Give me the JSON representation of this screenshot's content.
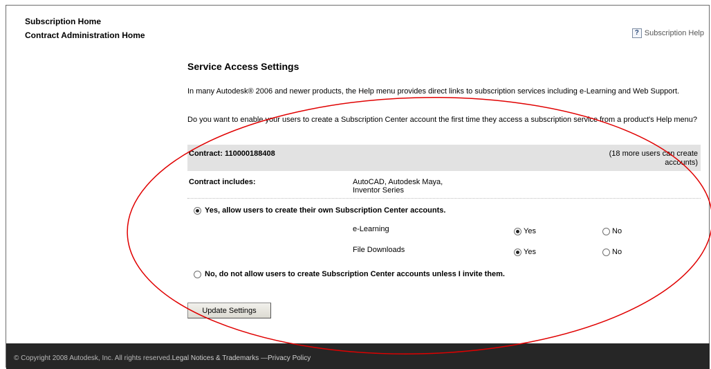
{
  "nav": {
    "subscription_home": "Subscription Home",
    "contract_admin_home": "Contract Administration Home"
  },
  "help": {
    "icon": "?",
    "label": "Subscription Help"
  },
  "main": {
    "title": "Service Access Settings",
    "para1": "In many Autodesk® 2006 and newer products, the Help menu provides direct links to subscription services including e-Learning and Web Support.",
    "para2": "Do you want to enable your users to create a Subscription Center account the first time they access a subscription service from a product's Help menu?",
    "contract": {
      "label": "Contract: 110000188408",
      "more_users": "(18 more users can create accounts)",
      "includes_label": "Contract includes:",
      "includes_line1": "AutoCAD, Autodesk Maya,",
      "includes_line2": "Inventor Series"
    },
    "option_yes": {
      "label": "Yes, allow users to create their own Subscription Center accounts.",
      "selected": true
    },
    "services": [
      {
        "name": "e-Learning",
        "yes": "Yes",
        "no": "No",
        "value": "Yes"
      },
      {
        "name": "File Downloads",
        "yes": "Yes",
        "no": "No",
        "value": "Yes"
      }
    ],
    "option_no": {
      "label": "No, do not allow users to create Subscription Center accounts unless I invite them.",
      "selected": false
    },
    "update_button": "Update Settings"
  },
  "footer": {
    "copyright": "© Copyright 2008 Autodesk, Inc. All rights reserved.",
    "legal": "Legal Notices & Trademarks",
    "sep": " —",
    "privacy": "Privacy Policy"
  },
  "colors": {
    "annotation": "#e00000",
    "footer_bg": "#262626",
    "contract_bar": "#e2e2e2"
  }
}
